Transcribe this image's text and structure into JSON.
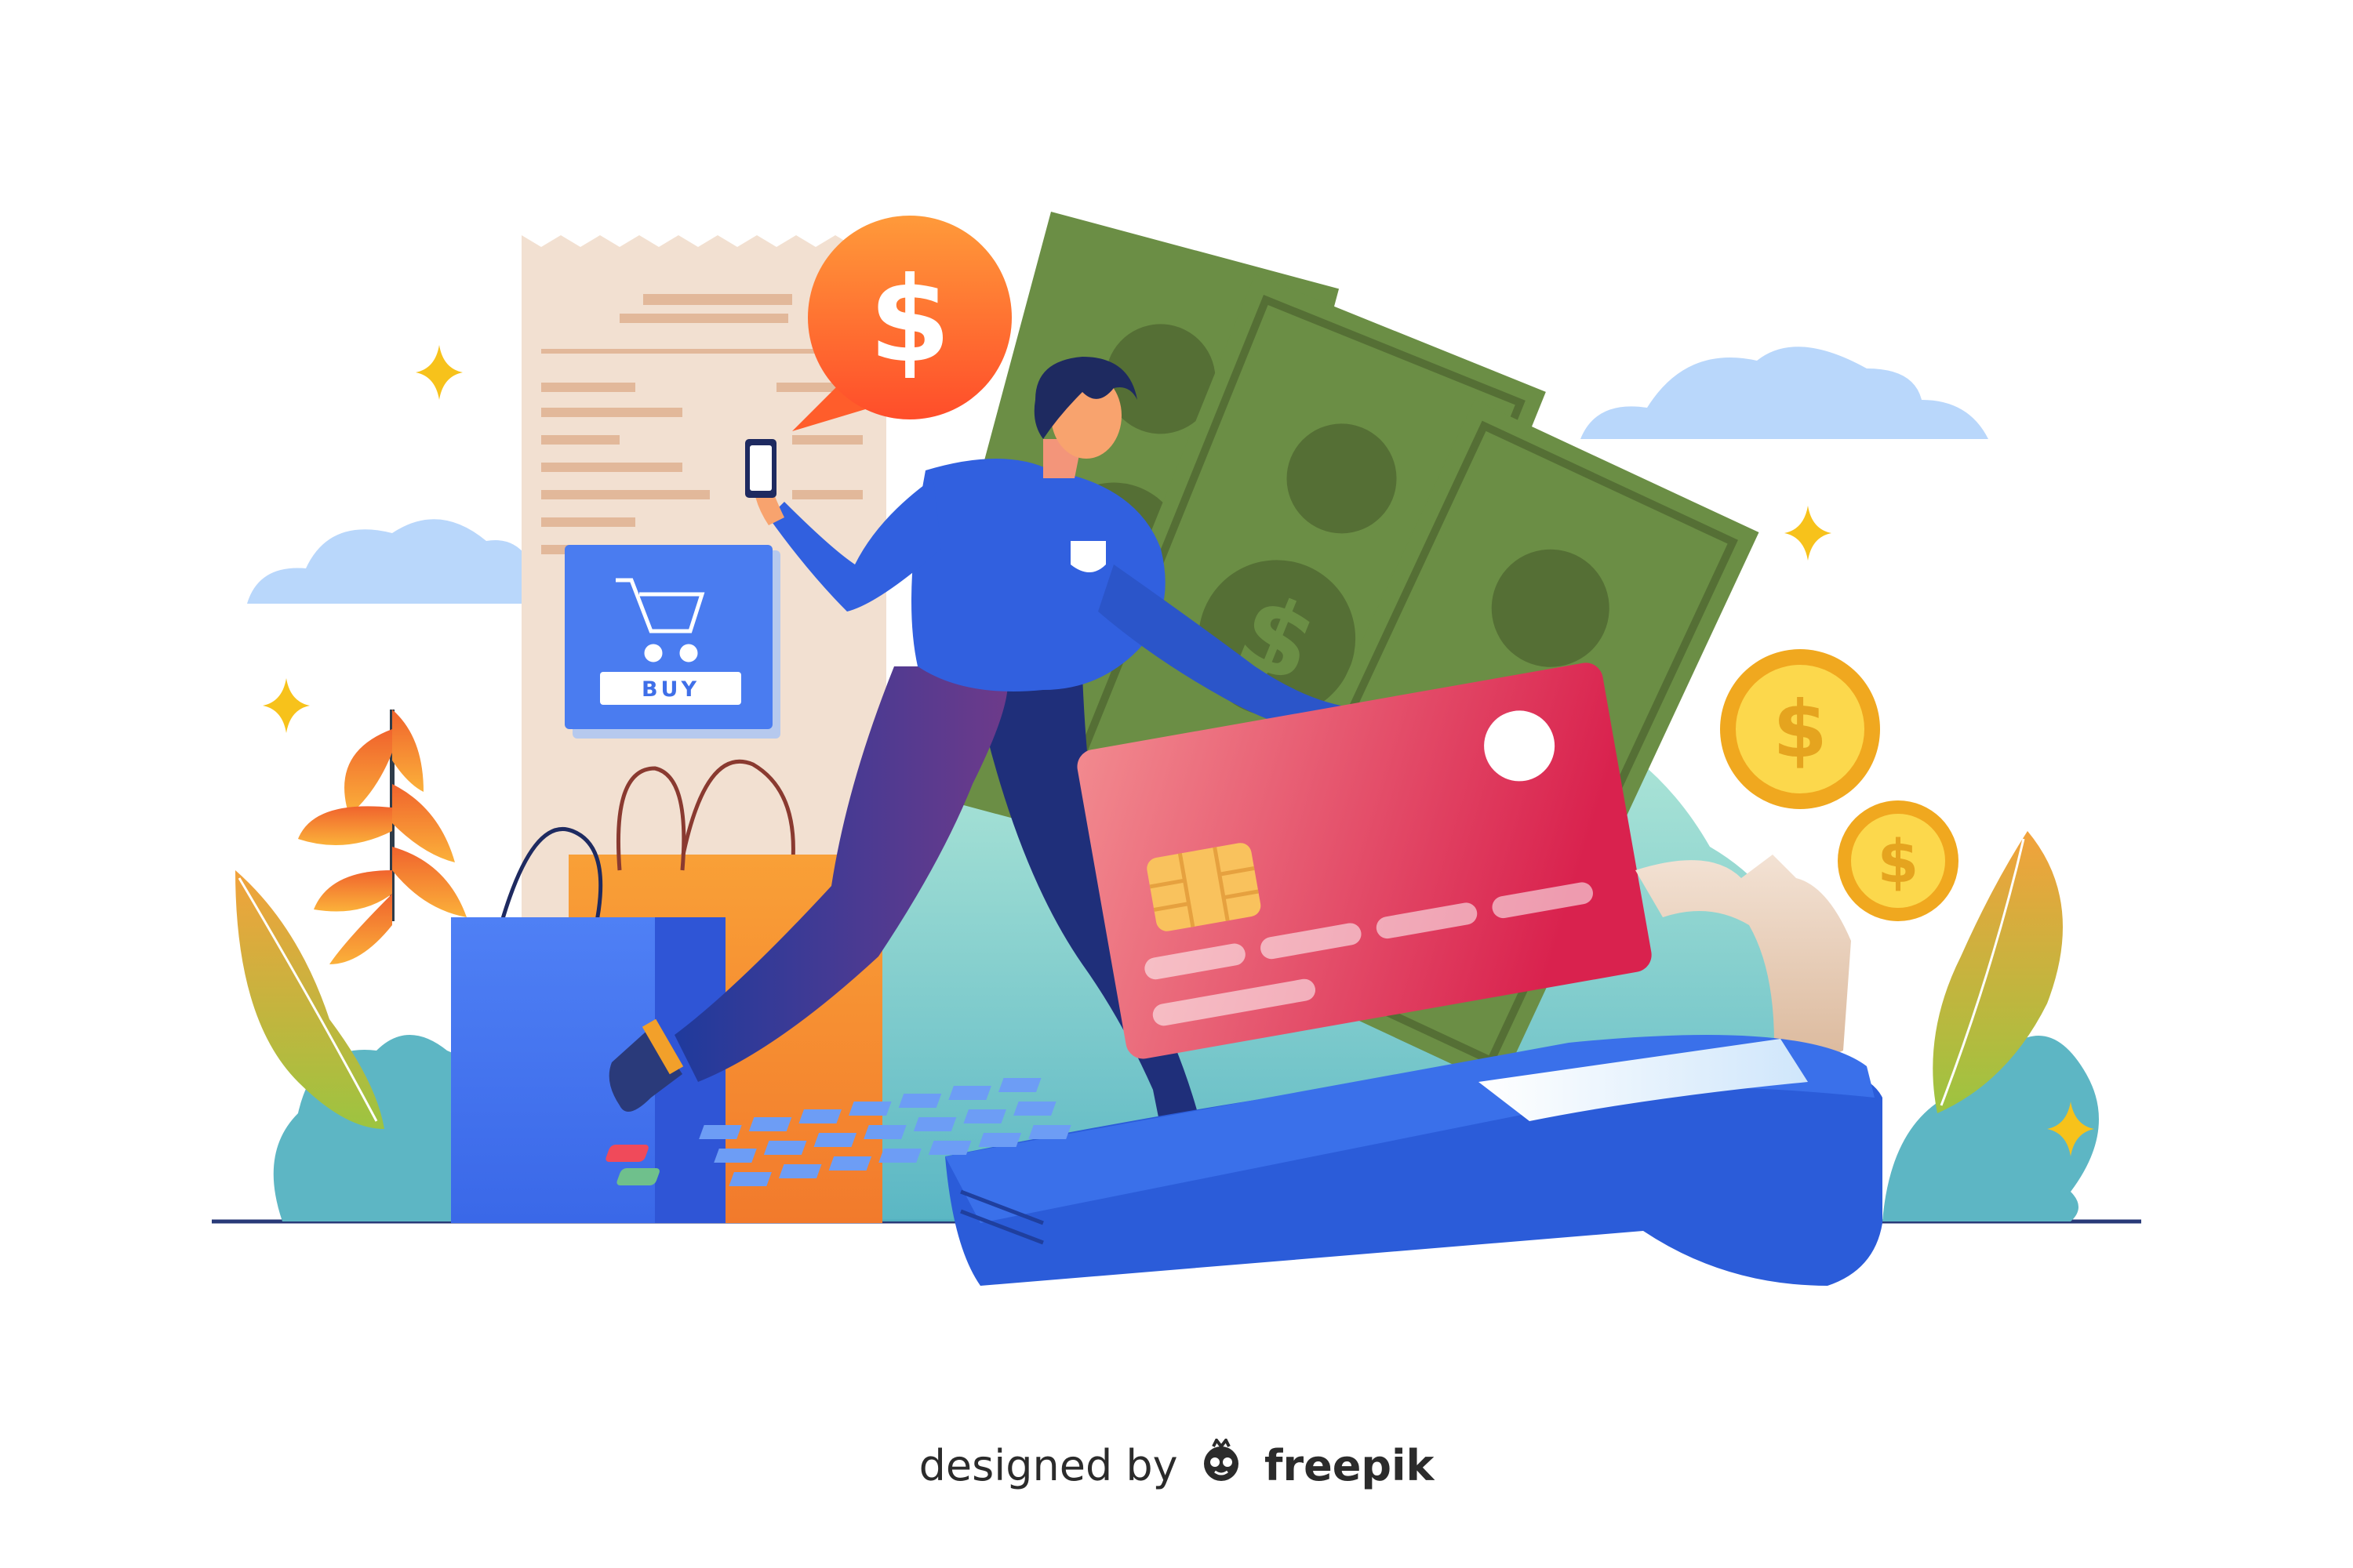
{
  "illustration": {
    "buy_button_label": "BUY",
    "speech_bubble_symbol": "$",
    "coin_symbol": "$",
    "bill_symbol": "$",
    "icons": [
      "cart-icon",
      "smartphone-icon",
      "dollar-icon",
      "credit-card-icon",
      "payment-terminal-icon",
      "shopping-bag-icon",
      "receipt-icon",
      "sparkle-icon",
      "coin-icon",
      "cloud-icon",
      "leaf-icon"
    ]
  },
  "credit": {
    "prefix": "designed by",
    "brand": "freepik"
  },
  "colors": {
    "background": "#ffffff",
    "bill_green": "#6b8e45",
    "card_red": "#e8445e",
    "terminal_blue": "#2f62e0",
    "bubble_orange": "#ff6a2c",
    "coin_gold": "#f5c12a",
    "sparkle_yellow": "#f7c21b",
    "cloud_blue": "#b9d7fb"
  }
}
